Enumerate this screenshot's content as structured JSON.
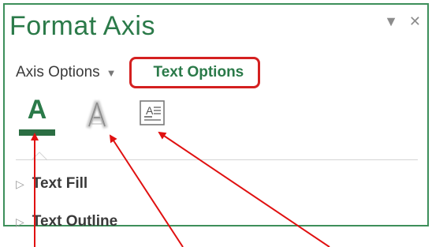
{
  "pane": {
    "title": "Format Axis",
    "dropdown_icon": "chevron-down-icon",
    "close_icon": "close-icon"
  },
  "tabs": {
    "axis_options": "Axis Options",
    "text_options": "Text Options"
  },
  "icons": {
    "text_fill_letter": "A",
    "text_outline_letter": "A",
    "text_box_letter": "A"
  },
  "sections": [
    {
      "label": "Text Fill"
    },
    {
      "label": "Text Outline"
    }
  ],
  "colors": {
    "accent_green": "#2b7a49",
    "highlight_red": "#d42020",
    "arrow_red": "#e01010"
  }
}
